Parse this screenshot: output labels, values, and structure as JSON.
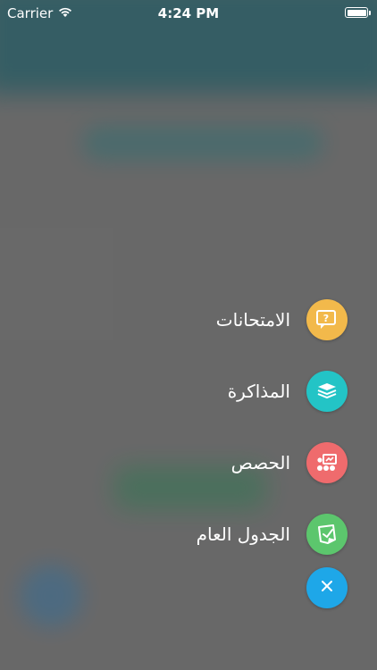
{
  "status_bar": {
    "carrier": "Carrier",
    "time": "4:24 PM",
    "wifi_icon": "wifi-icon",
    "battery_icon": "battery-icon"
  },
  "menu": {
    "items": [
      {
        "label": "الامتحانات",
        "icon": "exam-question-icon",
        "color": "#f2b94b"
      },
      {
        "label": "المذاكرة",
        "icon": "study-stack-icon",
        "color": "#23c4c6"
      },
      {
        "label": "الحصص",
        "icon": "classes-board-icon",
        "color": "#ef6b6d"
      },
      {
        "label": "الجدول العام",
        "icon": "schedule-note-icon",
        "color": "#5cc66d"
      }
    ],
    "close": {
      "icon": "close-icon",
      "color": "#1ea7e8"
    }
  }
}
